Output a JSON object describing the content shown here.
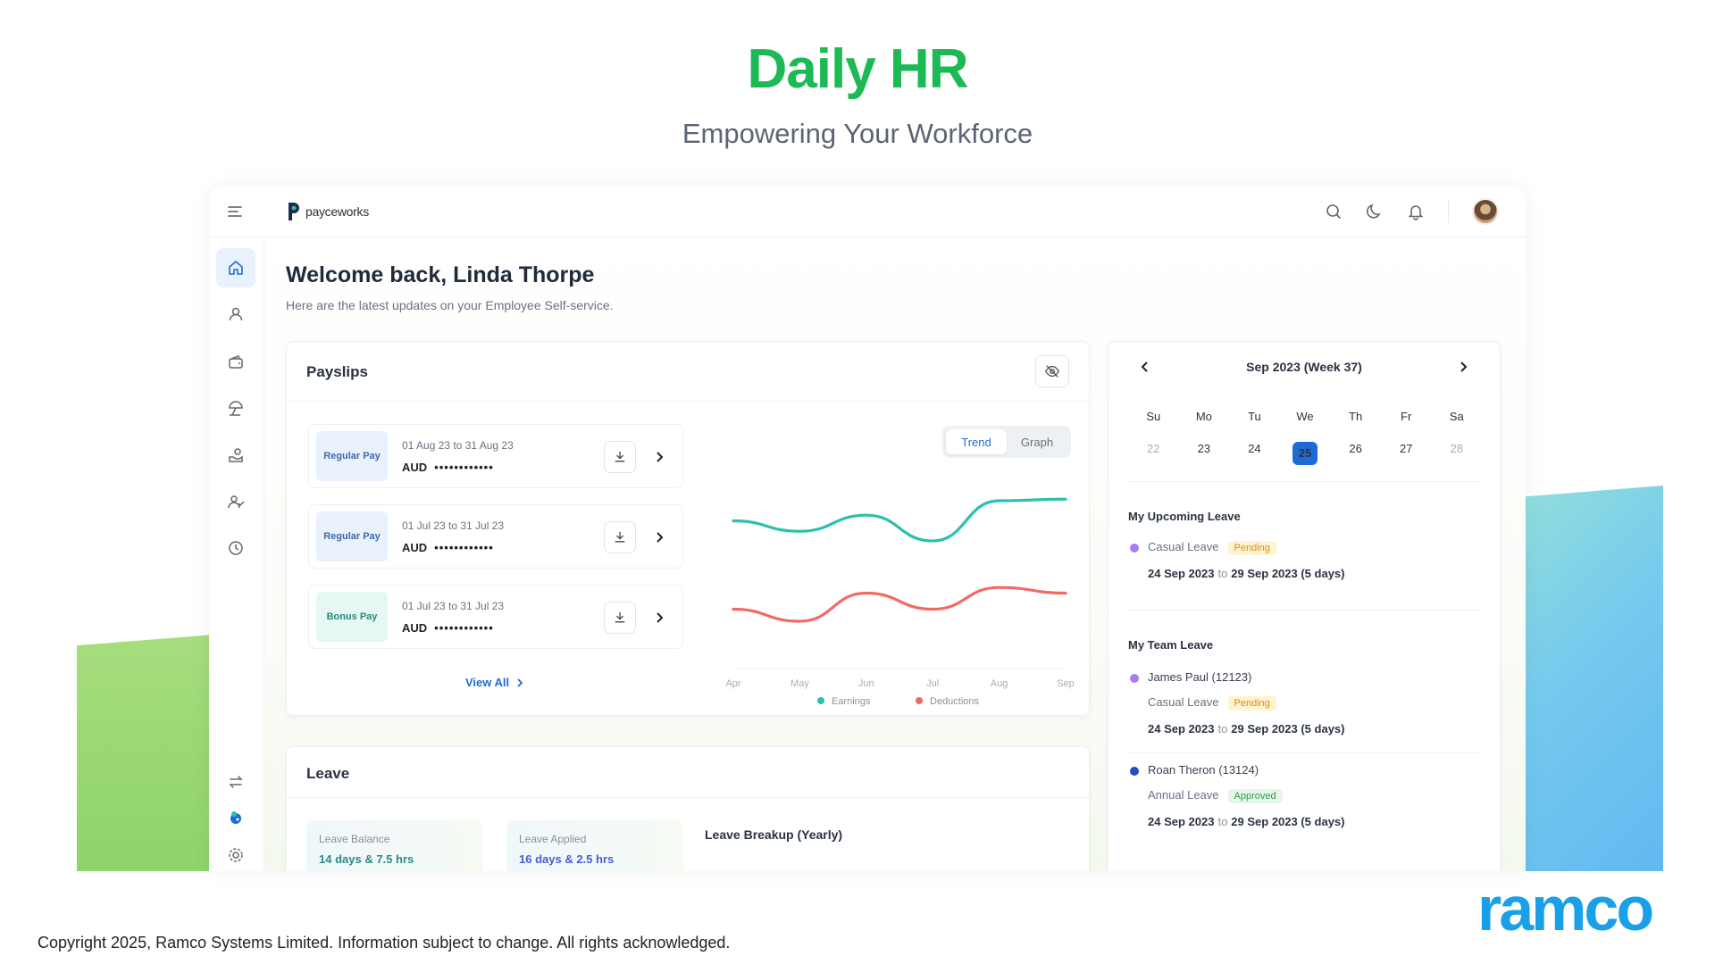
{
  "hero": {
    "title": "Daily HR",
    "subtitle": "Empowering Your Workforce"
  },
  "app": {
    "logo_text": "payceworks",
    "welcome": "Welcome back, Linda Thorpe",
    "welcome_sub": "Here are the latest updates on your Employee Self-service.",
    "colors": {
      "accent": "#1f6bd6",
      "earnings": "#2bbfae",
      "deductions": "#f26a63"
    }
  },
  "payslips": {
    "title": "Payslips",
    "items": [
      {
        "type": "Regular Pay",
        "period": "01 Aug 23 to 31 Aug 23",
        "currency": "AUD",
        "masked": "••••••••••••"
      },
      {
        "type": "Regular Pay",
        "period": "01 Jul 23 to 31 Jul 23",
        "currency": "AUD",
        "masked": "••••••••••••"
      },
      {
        "type": "Bonus Pay",
        "period": "01 Jul 23 to 31 Jul 23",
        "currency": "AUD",
        "masked": "••••••••••••"
      }
    ],
    "view_all": "View All",
    "toggle": {
      "trend": "Trend",
      "graph": "Graph"
    }
  },
  "chart_data": {
    "type": "line",
    "categories": [
      "Apr",
      "May",
      "Jun",
      "Jul",
      "Aug",
      "Sep"
    ],
    "series": [
      {
        "name": "Earnings",
        "values": [
          0.55,
          0.42,
          0.62,
          0.3,
          0.8,
          0.82
        ],
        "color": "#2bbfae"
      },
      {
        "name": "Deductions",
        "values": [
          -0.55,
          -0.7,
          -0.35,
          -0.55,
          -0.28,
          -0.35
        ],
        "color": "#f26a63"
      }
    ],
    "legend": "bottom"
  },
  "leave": {
    "title": "Leave",
    "balance_label": "Leave Balance",
    "balance_value": "14 days & 7.5 hrs",
    "applied_label": "Leave Applied",
    "applied_value": "16 days & 2.5 hrs",
    "breakup_title": "Leave Breakup (Yearly)"
  },
  "calendar": {
    "header": "Sep 2023 (Week 37)",
    "days": [
      "Su",
      "Mo",
      "Tu",
      "We",
      "Th",
      "Fr",
      "Sa"
    ],
    "dates": [
      "22",
      "23",
      "24",
      "25",
      "26",
      "27",
      "28"
    ],
    "today": "25",
    "upcoming_title": "My Upcoming Leave",
    "upcoming": {
      "type": "Casual Leave",
      "status": "Pending",
      "from": "24 Sep 2023",
      "to_word": "to",
      "to": "29 Sep 2023 (5 days)"
    },
    "team_title": "My Team Leave",
    "team": [
      {
        "name": "James Paul (12123)",
        "type": "Casual Leave",
        "status": "Pending",
        "from": "24 Sep 2023",
        "to_word": "to",
        "to": "29 Sep 2023 (5 days)"
      },
      {
        "name": "Roan Theron (13124)",
        "type": "Annual Leave",
        "status": "Approved",
        "from": "24 Sep 2023",
        "to_word": "to",
        "to": "29 Sep 2023 (5 days)"
      }
    ]
  },
  "footer": {
    "copyright": "Copyright 2025, Ramco Systems Limited. Information subject to change. All rights acknowledged.",
    "brand": "ramco"
  }
}
